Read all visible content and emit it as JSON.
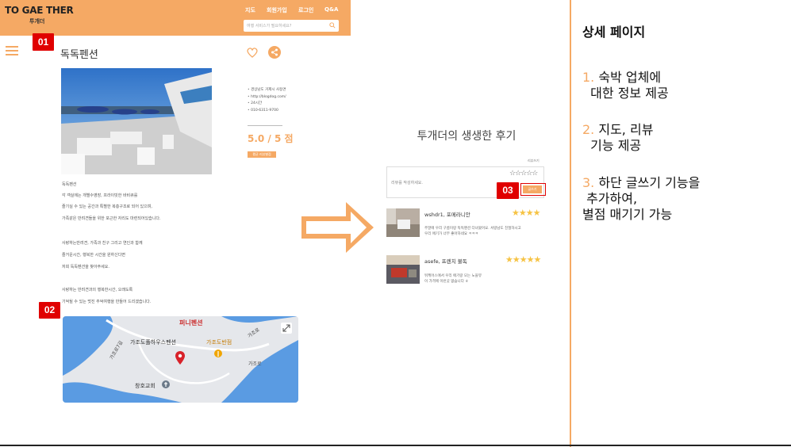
{
  "header": {
    "logo_main": "TO GAE THER",
    "logo_sub": "투개더",
    "nav": [
      "지도",
      "회원가입",
      "로그인",
      "Q&A"
    ],
    "search_placeholder": "여행 서비스가 필요하세요?"
  },
  "badges": [
    "01",
    "02",
    "03"
  ],
  "detail": {
    "title": "독독펜션",
    "info": [
      "경상남도 거제시 사등면",
      "http://blogdog.com/",
      "24시간",
      "010-6311-9700"
    ],
    "rating": "5.0 / 5 점",
    "rating_button": "평균 리뷰별점",
    "description": [
      "독독펜션",
      "각 객실에는 개별수영장, 프라이빗한 바비큐를",
      "즐기실 수 있는 공간과 특별한 복층구조로 되어 있으며,",
      "가족같은 반려견들을 위한 포근한 자리도 마련되어있습니다.",
      "사랑하는반려견, 가족과 친구 그리고 연인과 함께",
      "즐거운시간, 행복한 시간을 원하신다면",
      "저희 독독펜션을 찾아주세요.",
      "사랑하는 반려견과의 행복한시간, 오래도록",
      "기억될 수 있는 멋진 추억여행을 만들어 드리겠습니다."
    ]
  },
  "map": {
    "labels": [
      "퍼니펜션",
      "가조도풀하우스펜션",
      "가조도반점",
      "가조로",
      "가조로7길",
      "창호교회",
      "가조로"
    ]
  },
  "reviews": {
    "title": "투개더의 생생한 후기",
    "small_label": "리뷰쓰기",
    "placeholder": "리뷰를 작성하세요.",
    "empty_stars": "☆☆☆☆☆",
    "submit": "글쓰기",
    "items": [
      {
        "name": "wshdr1, 포메라니안",
        "stars": "★★★★",
        "lines": [
          "주말에 우리 구름이랑 독독펜션 다녀왔어요. 서랑남도 친절하시고",
          "우리 애기가 너무 좋아하네요 ㅋㅋㅋ"
        ]
      },
      {
        "name": "asefe, 프렌치 불독",
        "stars": "★★★★★",
        "lines": [
          "뒤케어스에서 우리 애기랑 모는 노을뷰",
          "이 가격에 이런곳 없습니다 ㅎ"
        ]
      }
    ]
  },
  "panel": {
    "title": "상세 페이지",
    "items": [
      {
        "num": "1.",
        "lines": [
          "숙박 업체에",
          "  대한 정보 제공"
        ]
      },
      {
        "num": "2.",
        "lines": [
          "지도, 리뷰",
          "  기능 제공"
        ]
      },
      {
        "num": "3.",
        "lines": [
          "하단 글쓰기 기능을",
          " 추가하여,",
          "별점 매기기 가능"
        ]
      }
    ]
  },
  "colors": {
    "accent": "#f5a964",
    "badge": "#e00000",
    "star": "#f6c344"
  }
}
